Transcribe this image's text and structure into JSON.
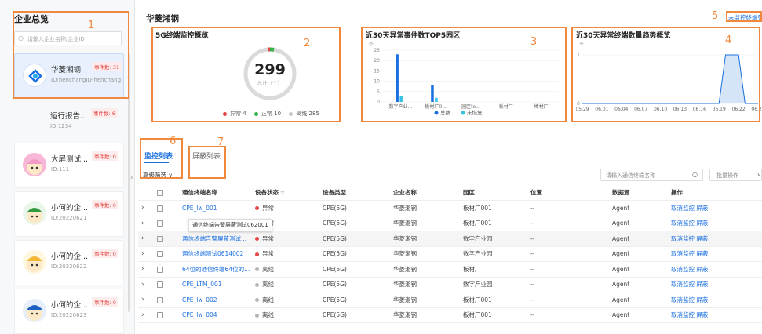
{
  "sidebar": {
    "title": "企业总览",
    "search_placeholder": "请输入企业名称/企业ID",
    "companies": [
      {
        "name": "华菱湘钢",
        "badge": "事件数: 31",
        "id": "ID:henchangID-henchang..."
      },
      {
        "name": "运行报告...",
        "badge": "事件数: 6",
        "id": "ID:1234"
      },
      {
        "name": "大屏测试...",
        "badge": "事件数: 0",
        "id": "ID:111"
      },
      {
        "name": "小何的企...",
        "badge": "事件数: 0",
        "id": "ID:20220621"
      },
      {
        "name": "小何的企...",
        "badge": "事件数: 0",
        "id": "ID:20220622"
      },
      {
        "name": "小何的企...",
        "badge": "事件数: 0",
        "id": "ID:20220623"
      }
    ]
  },
  "header": {
    "title": "华菱湘钢",
    "unmonitored_link": "未监控终端列"
  },
  "annotations": [
    "1",
    "2",
    "3",
    "4",
    "5",
    "6",
    "7"
  ],
  "panel1": {
    "title": "5G终端监控概览",
    "total": "299",
    "total_label": "总计（个）",
    "legend": [
      {
        "label": "异常 4",
        "color": "#e54545"
      },
      {
        "label": "正常 10",
        "color": "#35b24a"
      },
      {
        "label": "离线 285",
        "color": "#c8c8c8"
      }
    ]
  },
  "panel2": {
    "title": "近30天异常事件数TOP5园区",
    "unit": "个",
    "yticks": [
      "25",
      "20",
      "15",
      "10",
      "5",
      "0"
    ],
    "legend": [
      {
        "label": "总数",
        "color": "#1a6fe0"
      },
      {
        "label": "未恢复",
        "color": "#36c3e0"
      }
    ]
  },
  "panel3": {
    "title": "近30天异常终端数量趋势概览",
    "unit": "个",
    "yticks": [
      "1",
      "0"
    ],
    "xticks": [
      "05.29",
      "06.01",
      "06.04",
      "06.07",
      "06.10",
      "06.13",
      "06.16",
      "06.19",
      "06.22",
      "06.25"
    ]
  },
  "chart_data": [
    {
      "type": "bar",
      "title": "近30天异常事件数TOP5园区",
      "categories": [
        "数字产业...",
        "板材厂0...",
        "园区te...",
        "板材厂",
        "棒材厂"
      ],
      "series": [
        {
          "name": "总数",
          "values": [
            23,
            8,
            0,
            0,
            0
          ]
        },
        {
          "name": "未恢复",
          "values": [
            3,
            2,
            0,
            0,
            0
          ]
        }
      ],
      "ylim": [
        0,
        25
      ]
    },
    {
      "type": "area",
      "title": "近30天异常终端数量趋势概览",
      "x": [
        "05.29",
        "06.01",
        "06.04",
        "06.07",
        "06.10",
        "06.13",
        "06.16",
        "06.19",
        "06.20",
        "06.21",
        "06.22",
        "06.23",
        "06.25"
      ],
      "values": [
        0,
        0,
        0,
        0,
        0,
        0,
        0,
        0,
        1,
        1,
        1,
        0,
        0
      ],
      "ylim": [
        0,
        1
      ]
    }
  ],
  "tabs": {
    "active": "监控列表",
    "other": "屏蔽列表",
    "filter": "高级筛选"
  },
  "toolbar": {
    "search_placeholder": "请输入通信终端名称",
    "batch": "批量操作"
  },
  "table": {
    "headers": [
      "通信终端名称",
      "设备状态",
      "设备类型",
      "企业名称",
      "园区",
      "位置",
      "数据源",
      "操作"
    ],
    "tooltip": "通信终端告警屏蔽测试062001",
    "rows": [
      {
        "name": "CPE_lw_001",
        "status": "异常",
        "type": "CPE(5G)",
        "company": "华菱湘钢",
        "park": "板材厂001",
        "loc": "--",
        "src": "Agent",
        "op1": "取消监控",
        "op2": "屏蔽"
      },
      {
        "name": "",
        "status": "异常",
        "type": "CPE(5G)",
        "company": "华菱湘钢",
        "park": "板材厂001",
        "loc": "--",
        "src": "Agent",
        "op1": "取消监控",
        "op2": "屏蔽"
      },
      {
        "name": "通信终端告警屏蔽测试...",
        "status": "异常",
        "type": "CPE(5G)",
        "company": "华菱湘钢",
        "park": "数字产业园",
        "loc": "--",
        "src": "Agent",
        "op1": "取消监控",
        "op2": "屏蔽"
      },
      {
        "name": "通信终端测试0614002",
        "status": "异常",
        "type": "CPE(5G)",
        "company": "华菱湘钢",
        "park": "数字产业园",
        "loc": "--",
        "src": "Agent",
        "op1": "取消监控",
        "op2": "屏蔽"
      },
      {
        "name": "64位的通信终端64位的...",
        "status": "离线",
        "type": "CPE(5G)",
        "company": "华菱湘钢",
        "park": "板材厂",
        "loc": "--",
        "src": "Agent",
        "op1": "取消监控",
        "op2": "屏蔽"
      },
      {
        "name": "CPE_LTM_001",
        "status": "离线",
        "type": "CPE(5G)",
        "company": "华菱湘钢",
        "park": "数字产业园",
        "loc": "--",
        "src": "Agent",
        "op1": "取消监控",
        "op2": "屏蔽"
      },
      {
        "name": "CPE_lw_002",
        "status": "离线",
        "type": "CPE(5G)",
        "company": "华菱湘钢",
        "park": "板材厂001",
        "loc": "--",
        "src": "Agent",
        "op1": "取消监控",
        "op2": "屏蔽"
      },
      {
        "name": "CPE_lw_004",
        "status": "离线",
        "type": "CPE(5G)",
        "company": "华菱湘钢",
        "park": "板材厂001",
        "loc": "--",
        "src": "Agent",
        "op1": "取消监控",
        "op2": "屏蔽"
      }
    ]
  }
}
